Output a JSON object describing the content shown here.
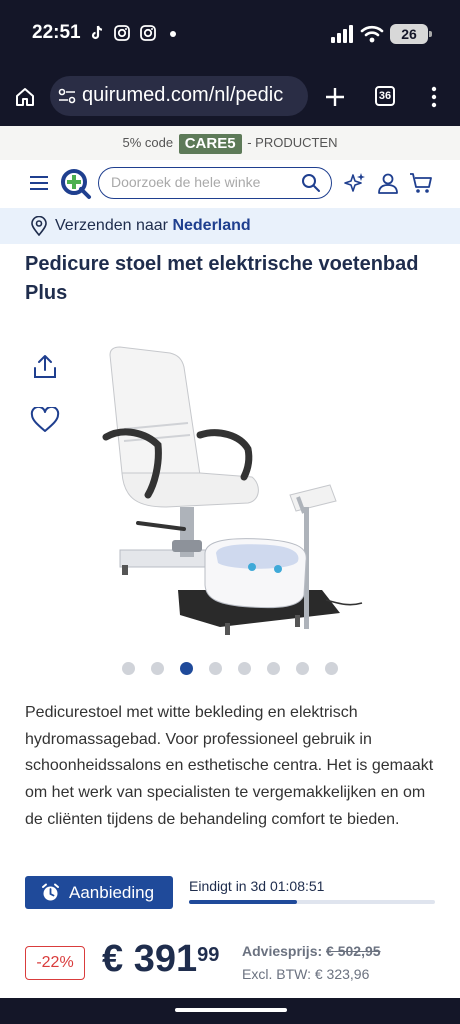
{
  "status_bar": {
    "time": "22:51",
    "battery": "26",
    "icons": [
      "tiktok-icon",
      "instagram-icon",
      "instagram-icon",
      "signal-icon",
      "wifi-icon",
      "battery-icon"
    ]
  },
  "browser": {
    "url": "quirumed.com/nl/pedic",
    "tab_count": "36"
  },
  "promo": {
    "prefix": "5% code",
    "code": "CARE5",
    "suffix": "- PRODUCTEN"
  },
  "header": {
    "search_placeholder": "Doorzoek de hele winke"
  },
  "shipping": {
    "label": "Verzenden naar",
    "country": "Nederland"
  },
  "product": {
    "title": "Pedicure stoel met elektrische voetenbad Plus",
    "gallery": {
      "total_images": 8,
      "active_index": 2
    },
    "description": "Pedicurestoel met witte bekleding en elektrisch hydromassagebad. Voor professioneel gebruik in schoonheidssalons en esthetische centra. Het is gemaakt om het werk van specialisten te vergemakkelijken en om de cliënten tijdens de behandeling comfort te bieden."
  },
  "offer": {
    "button_label": "Aanbieding",
    "countdown": "Eindigt in 3d 01:08:51",
    "progress": 0.44
  },
  "pricing": {
    "discount": "-22%",
    "price_main": "€ 391",
    "price_cents": "99",
    "advies_label": "Adviesprijs:",
    "advies_price": "€ 502,95",
    "excl_btw": "Excl. BTW: € 323,96"
  },
  "colors": {
    "brand_blue": "#1f4a9a",
    "dark_bar": "#141628",
    "discount_red": "#d93c3c",
    "code_green": "#5d7a58"
  }
}
